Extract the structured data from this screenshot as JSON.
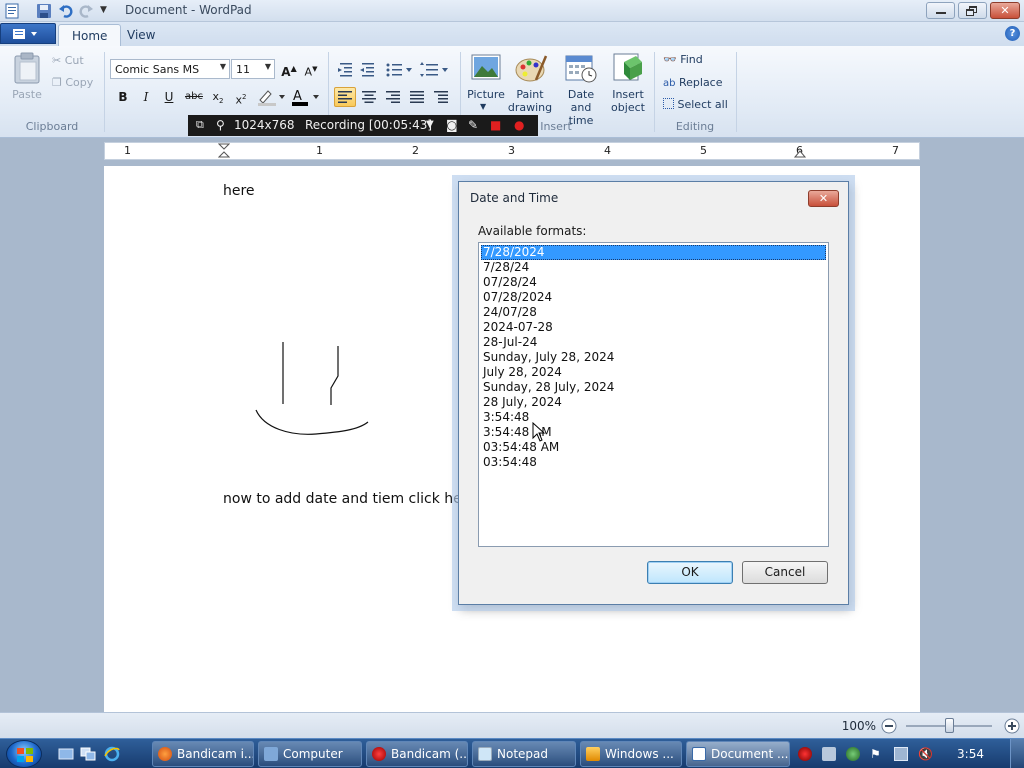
{
  "window": {
    "title": "Document - WordPad"
  },
  "ribbon": {
    "tabs": [
      "Home",
      "View"
    ],
    "clipboard": {
      "paste": "Paste",
      "cut": "Cut",
      "copy": "Copy",
      "group": "Clipboard"
    },
    "font": {
      "family": "Comic Sans MS",
      "size": "11"
    },
    "insert": {
      "picture": "Picture",
      "paint1": "Paint",
      "paint2": "drawing",
      "date1": "Date and",
      "date2": "time",
      "object1": "Insert",
      "object2": "object",
      "group": "Insert"
    },
    "editing": {
      "find": "Find",
      "replace": "Replace",
      "select_all": "Select all",
      "group": "Editing"
    }
  },
  "recorder": {
    "resolution": "1024x768",
    "status": "Recording [00:05:43]"
  },
  "ruler": {
    "numbers": [
      "1",
      "1",
      "2",
      "3",
      "4",
      "5",
      "6",
      "7"
    ]
  },
  "document": {
    "line1": "here",
    "line2": "now to add date and tiem click her"
  },
  "dialog": {
    "title": "Date and Time",
    "label": "Available formats:",
    "formats": [
      "7/28/2024",
      "7/28/24",
      "07/28/24",
      "07/28/2024",
      "24/07/28",
      "2024-07-28",
      "28-Jul-24",
      "Sunday, July 28, 2024",
      "July 28, 2024",
      "Sunday, 28 July, 2024",
      "28 July, 2024",
      "3:54:48",
      "3:54:48 AM",
      "03:54:48 AM",
      "03:54:48"
    ],
    "selected_index": 0,
    "ok": "OK",
    "cancel": "Cancel"
  },
  "statusbar": {
    "zoom": "100%"
  },
  "taskbar": {
    "items": [
      "Bandicam i...",
      "Computer",
      "Bandicam (...",
      "Notepad",
      "Windows ...",
      "Document ..."
    ],
    "clock": "3:54"
  },
  "colors": {
    "selection": "#3399ff",
    "taskbar": "#1f4a80",
    "accent": "#1e5bb5"
  }
}
